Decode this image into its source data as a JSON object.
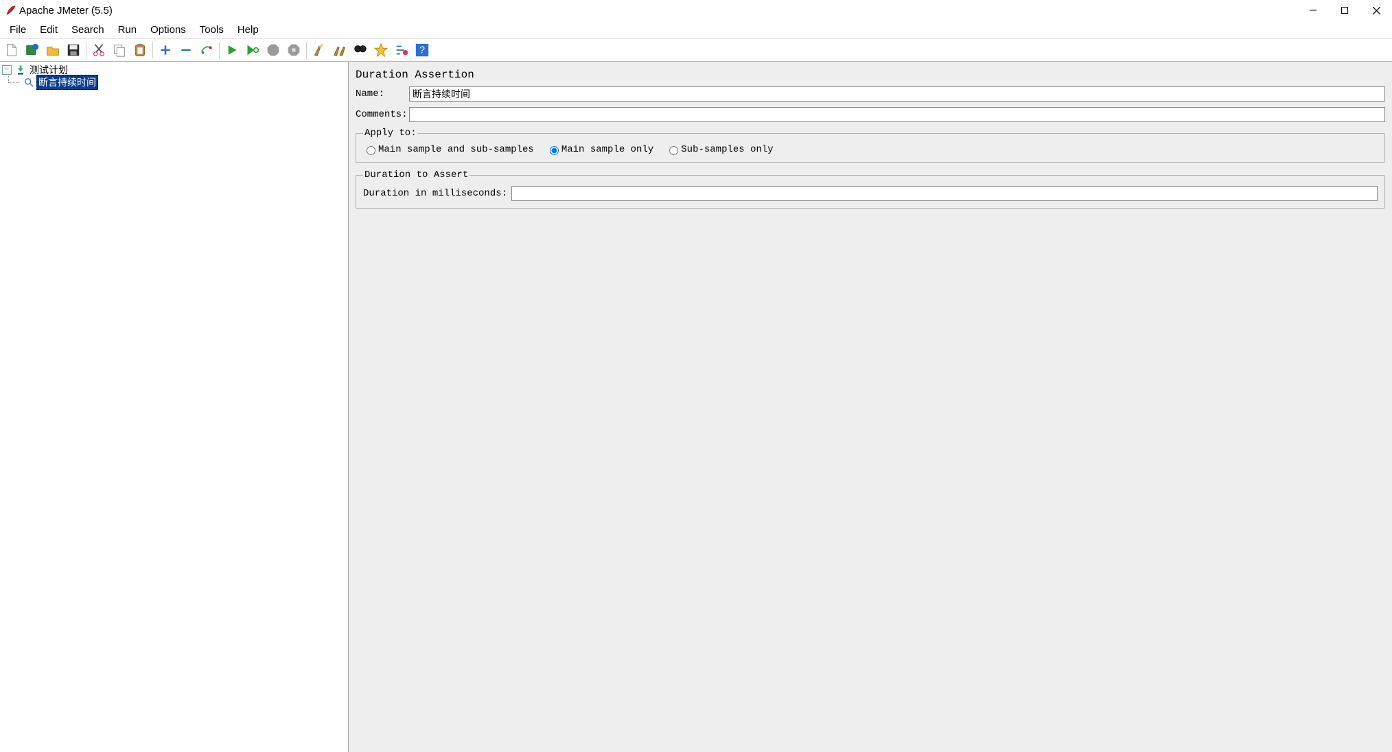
{
  "window": {
    "title": "Apache JMeter (5.5)"
  },
  "menubar": [
    "File",
    "Edit",
    "Search",
    "Run",
    "Options",
    "Tools",
    "Help"
  ],
  "toolbar_icons": [
    "new-icon",
    "templates-icon",
    "open-icon",
    "save-icon",
    "cut-icon",
    "copy-icon",
    "paste-icon",
    "add-icon",
    "remove-icon",
    "enable-disable-icon",
    "start-icon",
    "start-no-pauses-icon",
    "stop-icon",
    "shutdown-icon",
    "clear-icon",
    "clear-all-icon",
    "search-icon",
    "search-reset-icon",
    "function-helper-icon",
    "help-icon"
  ],
  "tree": {
    "root": {
      "label": "测试计划"
    },
    "child": {
      "label": "断言持续时间"
    }
  },
  "panel": {
    "heading": "Duration Assertion",
    "name_label": "Name:",
    "name_value": "断言持续时间",
    "comments_label": "Comments:",
    "comments_value": "",
    "apply_to": {
      "legend": "Apply to:",
      "options": [
        {
          "label": "Main sample and sub-samples",
          "checked": false
        },
        {
          "label": "Main sample only",
          "checked": true
        },
        {
          "label": "Sub-samples only",
          "checked": false
        }
      ]
    },
    "duration": {
      "legend": "Duration to Assert",
      "label": "Duration in milliseconds:",
      "value": ""
    }
  }
}
